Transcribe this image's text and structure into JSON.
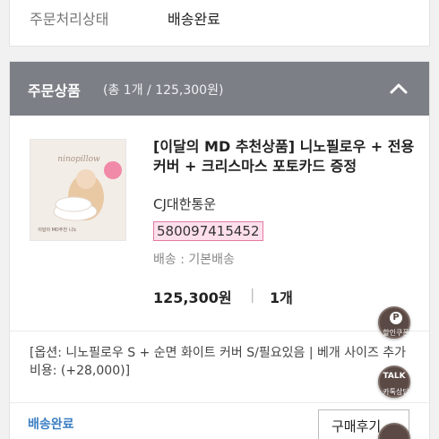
{
  "order_status": {
    "label": "주문처리상태",
    "value": "배송완료"
  },
  "products_header": {
    "title": "주문상품",
    "summary": "(총 1개 / 125,300원)"
  },
  "product": {
    "name": "[이달의 MD 추천상품] 니노필로우 + 전용커버 + 크리스마스 포토카드 증정",
    "carrier": "CJ대한통운",
    "tracking_number": "580097415452",
    "shipping_method": "배송 : 기본배송",
    "price": "125,300원",
    "separator": "|",
    "quantity": "1개",
    "option": "[옵션: 니노필로우 S + 순면 화이트 커버 S/필요있음 | 베개 사이즈 추가비용: (+28,000)]",
    "thumbnail": {
      "brand_text": "ninopillow",
      "caption": "이달의 MD추천 니노"
    }
  },
  "footer": {
    "status": "배송완료",
    "review_button": "구매후기"
  },
  "floating_buttons": {
    "coupon_label": "할인쿠폰",
    "coupon_glyph": "P",
    "talk_glyph": "TALK",
    "talk_label": "카톡상담"
  },
  "colors": {
    "header_bg": "#7c7f85",
    "status_blue": "#3c7fc4",
    "tracking_highlight": "#fde0ec",
    "float_btn": "#5a4944"
  }
}
